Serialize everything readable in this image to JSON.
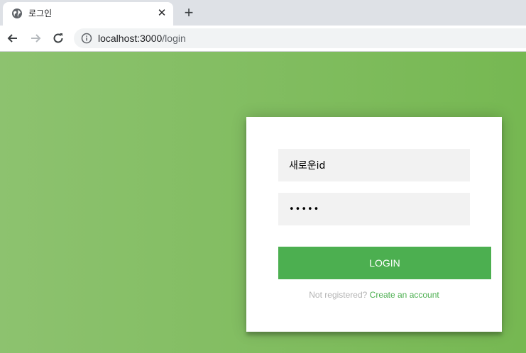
{
  "browser": {
    "tab": {
      "title": "로그인",
      "favicon": "globe-icon",
      "close_glyph": "✕"
    },
    "new_tab_glyph": "+",
    "nav": {
      "back": "arrow-left-icon",
      "forward": "arrow-right-icon",
      "reload": "reload-icon"
    },
    "address": {
      "host": "localhost:3000",
      "path": "/login",
      "info": "info-icon"
    }
  },
  "login_form": {
    "username_value": "새로운id",
    "password_value": "•••••",
    "submit_label": "LOGIN",
    "message_prefix": "Not registered?",
    "create_account_label": "Create an account"
  },
  "colors": {
    "background_left": "#8dc26f",
    "background_right": "#76b852",
    "button": "#4caf50",
    "link": "#4caf50"
  }
}
